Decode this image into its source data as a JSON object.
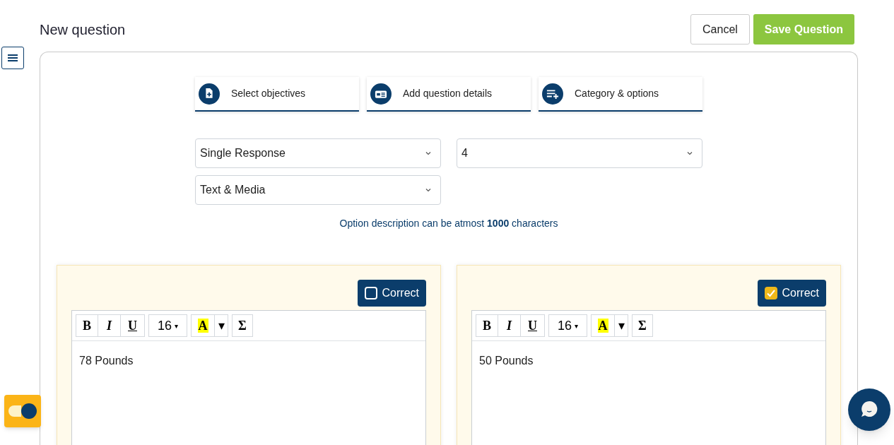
{
  "header": {
    "title": "New question",
    "buttons": [
      {
        "kind": "secondary",
        "label": "Cancel"
      },
      {
        "kind": "primary",
        "label": "Save Question"
      }
    ]
  },
  "steps": [
    {
      "label": "Select objectives",
      "kind": "file-plus"
    },
    {
      "label": "Add question details",
      "kind": "card"
    },
    {
      "label": "Category & options",
      "kind": "list-plus"
    }
  ],
  "selects": [
    {
      "value": "Single Response"
    },
    {
      "value": "4"
    },
    {
      "value": "Text & Media"
    }
  ],
  "note": "Option description can be atmost **1000** characters",
  "options": [
    {
      "correct_label": "Correct",
      "correct": false,
      "toolbar": {
        "bold": "B",
        "italic": "I",
        "underline": "U",
        "size": "16",
        "size_caret": "▾",
        "highlight": "A",
        "highlight_caret": "▾",
        "sigma": "Σ"
      },
      "text": "78 Pounds"
    },
    {
      "correct_label": "Correct",
      "correct": true,
      "toolbar": {
        "bold": "B",
        "italic": "I",
        "underline": "U",
        "size": "16",
        "size_caret": "▾",
        "highlight": "A",
        "highlight_caret": "▾",
        "sigma": "Σ"
      },
      "text": "50 Pounds"
    }
  ],
  "toggle": {
    "on": true
  }
}
